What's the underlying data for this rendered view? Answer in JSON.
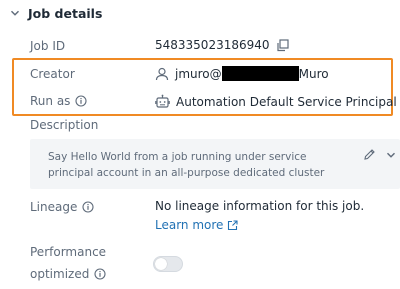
{
  "section": {
    "title": "Job details"
  },
  "fields": {
    "job_id": {
      "label": "Job ID",
      "value": "548335023186940"
    },
    "creator": {
      "label": "Creator",
      "prefix": "jmuro@",
      "suffix": "Muro"
    },
    "run_as": {
      "label": "Run as",
      "value": "Automation Default Service Principal"
    },
    "description": {
      "label": "Description",
      "text": "Say Hello World from a job running under service principal account in an all-purpose dedicated cluster"
    },
    "lineage": {
      "label": "Lineage",
      "text": "No lineage information for this job.",
      "link": "Learn more"
    },
    "performance": {
      "label_line1": "Performance",
      "label_line2": "optimized",
      "enabled": false
    }
  },
  "colors": {
    "highlight": "#f08a24",
    "link": "#2272b4",
    "label": "#5f6b7a",
    "text": "#1f2a36"
  },
  "icons": [
    "chevron-down-icon",
    "copy-icon",
    "user-icon",
    "robot-icon",
    "info-icon",
    "pencil-icon",
    "external-link-icon"
  ]
}
